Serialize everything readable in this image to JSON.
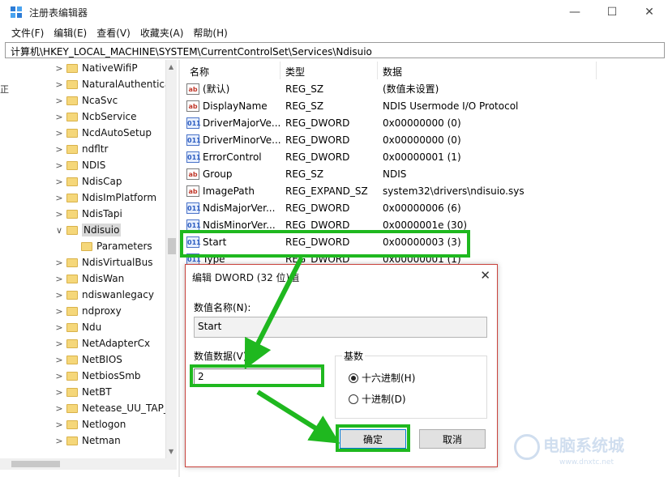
{
  "window": {
    "title": "注册表编辑器",
    "minimize_glyph": "—",
    "maximize_glyph": "☐",
    "close_glyph": "✕"
  },
  "menu": [
    "文件(F)",
    "编辑(E)",
    "查看(V)",
    "收藏夹(A)",
    "帮助(H)"
  ],
  "address": "计算机\\HKEY_LOCAL_MACHINE\\SYSTEM\\CurrentControlSet\\Services\\Ndisuio",
  "tree": {
    "stub_label": "正",
    "items": [
      {
        "label": "NativeWifiP",
        "expand": ">"
      },
      {
        "label": "NaturalAuthentica",
        "expand": ">"
      },
      {
        "label": "NcaSvc",
        "expand": ">"
      },
      {
        "label": "NcbService",
        "expand": ">"
      },
      {
        "label": "NcdAutoSetup",
        "expand": ">"
      },
      {
        "label": "ndfltr",
        "expand": ">"
      },
      {
        "label": "NDIS",
        "expand": ">"
      },
      {
        "label": "NdisCap",
        "expand": ">"
      },
      {
        "label": "NdisImPlatform",
        "expand": ">"
      },
      {
        "label": "NdisTapi",
        "expand": ">"
      },
      {
        "label": "Ndisuio",
        "expand": "∨",
        "selected": true
      },
      {
        "label": "Parameters",
        "expand": "",
        "child": true
      },
      {
        "label": "NdisVirtualBus",
        "expand": ">"
      },
      {
        "label": "NdisWan",
        "expand": ">"
      },
      {
        "label": "ndiswanlegacy",
        "expand": ">"
      },
      {
        "label": "ndproxy",
        "expand": ">"
      },
      {
        "label": "Ndu",
        "expand": ">"
      },
      {
        "label": "NetAdapterCx",
        "expand": ">"
      },
      {
        "label": "NetBIOS",
        "expand": ">"
      },
      {
        "label": "NetbiosSmb",
        "expand": ">"
      },
      {
        "label": "NetBT",
        "expand": ">"
      },
      {
        "label": "Netease_UU_TAP_",
        "expand": ">"
      },
      {
        "label": "Netlogon",
        "expand": ">"
      },
      {
        "label": "Netman",
        "expand": ">"
      }
    ]
  },
  "list": {
    "headers": {
      "name": "名称",
      "type": "类型",
      "data": "数据"
    },
    "rows": [
      {
        "icon": "ab",
        "icon_name": "string-value-icon",
        "name": "(默认)",
        "type": "REG_SZ",
        "data": "(数值未设置)"
      },
      {
        "icon": "ab",
        "icon_name": "string-value-icon",
        "name": "DisplayName",
        "type": "REG_SZ",
        "data": "NDIS Usermode I/O Protocol"
      },
      {
        "icon": "011",
        "icon_name": "dword-value-icon",
        "name": "DriverMajorVe...",
        "type": "REG_DWORD",
        "data": "0x00000000 (0)"
      },
      {
        "icon": "011",
        "icon_name": "dword-value-icon",
        "name": "DriverMinorVe...",
        "type": "REG_DWORD",
        "data": "0x00000000 (0)"
      },
      {
        "icon": "011",
        "icon_name": "dword-value-icon",
        "name": "ErrorControl",
        "type": "REG_DWORD",
        "data": "0x00000001 (1)"
      },
      {
        "icon": "ab",
        "icon_name": "string-value-icon",
        "name": "Group",
        "type": "REG_SZ",
        "data": "NDIS"
      },
      {
        "icon": "ab",
        "icon_name": "string-value-icon",
        "name": "ImagePath",
        "type": "REG_EXPAND_SZ",
        "data": "system32\\drivers\\ndisuio.sys"
      },
      {
        "icon": "011",
        "icon_name": "dword-value-icon",
        "name": "NdisMajorVer...",
        "type": "REG_DWORD",
        "data": "0x00000006 (6)"
      },
      {
        "icon": "011",
        "icon_name": "dword-value-icon",
        "name": "NdisMinorVer...",
        "type": "REG_DWORD",
        "data": "0x0000001e (30)"
      },
      {
        "icon": "011",
        "icon_name": "dword-value-icon",
        "name": "Start",
        "type": "REG_DWORD",
        "data": "0x00000003 (3)"
      },
      {
        "icon": "011",
        "icon_name": "dword-value-icon",
        "name": "Type",
        "type": "REG_DWORD",
        "data": "0x00000001 (1)"
      }
    ]
  },
  "dialog": {
    "title": "编辑 DWORD (32 位)值",
    "close_glyph": "✕",
    "name_label": "数值名称(N):",
    "name_value": "Start",
    "data_label": "数值数据(V):",
    "data_value": "2",
    "base_label": "基数",
    "radio_hex": "十六进制(H)",
    "radio_dec": "十进制(D)",
    "selected_base": "hex",
    "ok_label": "确定",
    "cancel_label": "取消"
  },
  "watermark": {
    "text": "电脑系统城",
    "sub": "www.dnxtc.net"
  },
  "colors": {
    "highlight": "#1fb81f",
    "dialog_border": "#c9433d"
  }
}
